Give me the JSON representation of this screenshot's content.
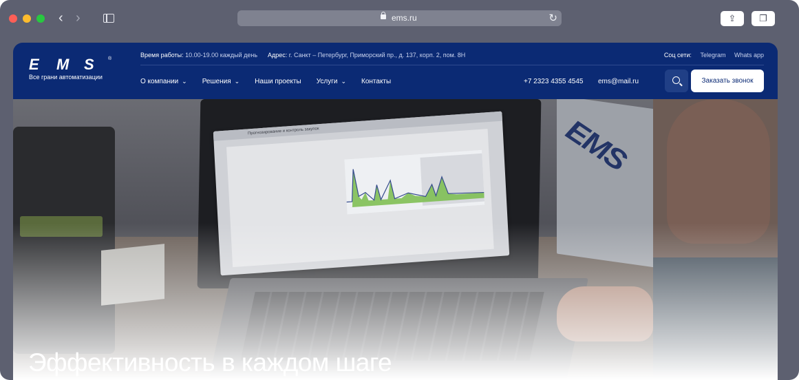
{
  "browser": {
    "url": "ems.ru"
  },
  "header": {
    "logo_text": "Все грани автоматизации",
    "logo_mark": [
      "E",
      "M",
      "S"
    ],
    "hours_label": "Время работы:",
    "hours_value": "10.00-19.00 каждый день",
    "address_label": "Адрес:",
    "address_value": "г. Санкт – Петербург, Приморский пр., д. 137, корп. 2, пом. 8Н",
    "social_label": "Соц сети:",
    "social_links": [
      "Telegram",
      "Whats app"
    ],
    "menu": [
      {
        "label": "О компании",
        "has_dropdown": true
      },
      {
        "label": "Решения",
        "has_dropdown": true
      },
      {
        "label": "Наши проекты",
        "has_dropdown": false
      },
      {
        "label": "Услуги",
        "has_dropdown": true
      },
      {
        "label": "Контакты",
        "has_dropdown": false
      }
    ],
    "phone": "+7 2323 4355 4545",
    "email": "ems@mail.ru",
    "cta_label": "Заказать звонок",
    "brand_color": "#0b2a74"
  },
  "hero": {
    "title": "Эффективность в каждом шаге",
    "screen_window_title": "Прогнозирование и контроль закупок"
  }
}
